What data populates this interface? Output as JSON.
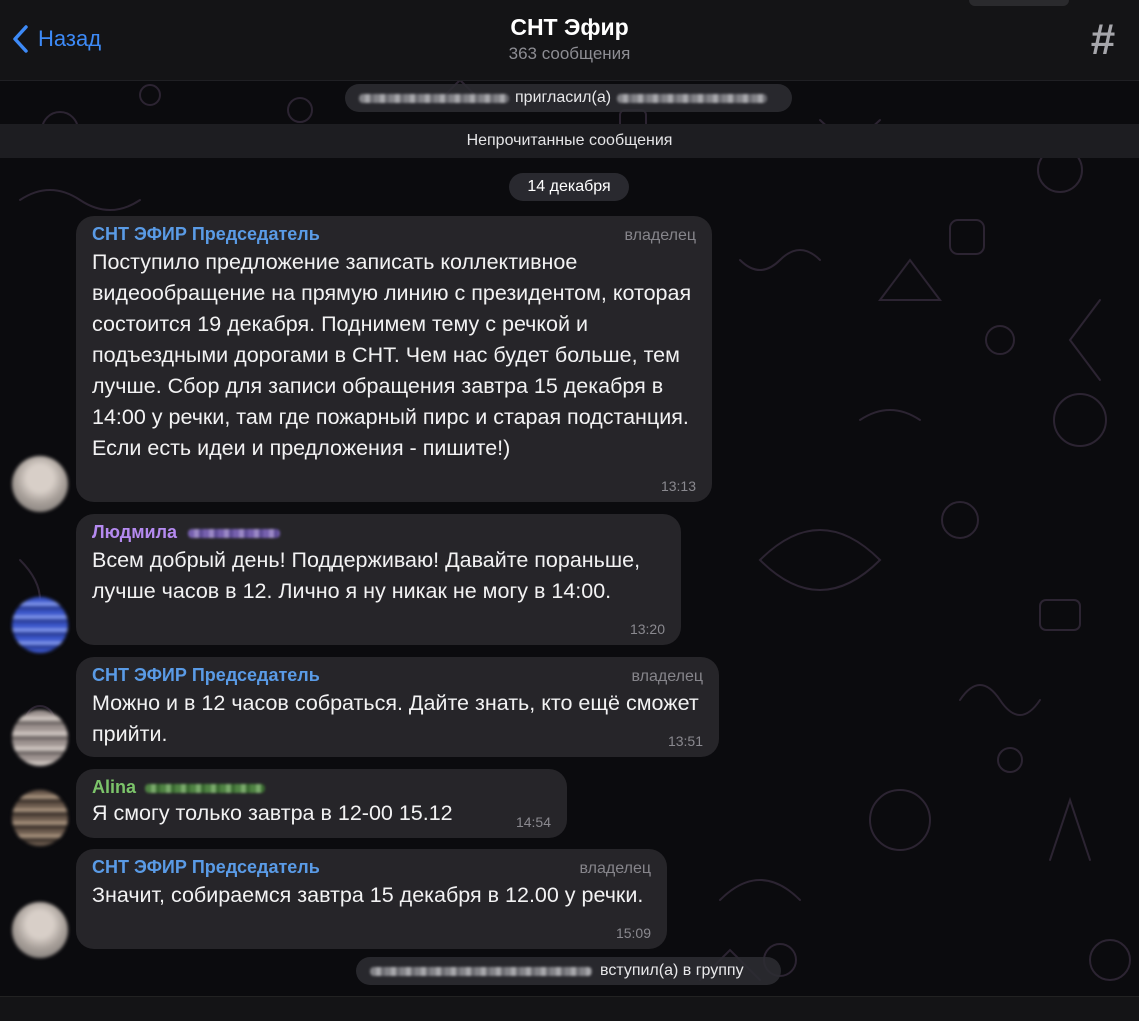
{
  "header": {
    "back_label": "Назад",
    "title": "СНТ Эфир",
    "subtitle": "363 сообщения",
    "action_icon": "hash-icon",
    "action_glyph": "#"
  },
  "service_top": {
    "text": "пригласил(а)"
  },
  "unread_label": "Непрочитанные сообщения",
  "date_label": "14 декабря",
  "colors": {
    "accent": "#3d8af7",
    "sender_admin": "#5a9be6",
    "sender_ludmila": "#b58af0",
    "sender_alina": "#7cc46a"
  },
  "messages": [
    {
      "sender": "СНТ ЭФИР Председатель",
      "badge": "владелец",
      "text": "Поступило предложение записать коллективное видеообращение на прямую линию с президентом, которая состоится 19 декабря. Поднимем тему с речкой и подъездными дорогами в СНТ. Чем нас будет больше, тем лучше. Сбор для записи обращения завтра 15 декабря в 14:00 у речки, там где пожарный пирс и старая подстанция. Если есть идеи и предложения - пишите!)",
      "time": "13:13"
    },
    {
      "sender": "Людмила",
      "badge": "",
      "text": "Всем добрый день! Поддерживаю! Давайте пораньше, лучше часов в 12. Лично я ну никак не могу в 14:00.",
      "time": "13:20"
    },
    {
      "sender": "СНТ ЭФИР Председатель",
      "badge": "владелец",
      "text": "Можно и в 12 часов собраться. Дайте знать, кто ещё сможет прийти.",
      "time": "13:51"
    },
    {
      "sender": "Alina",
      "badge": "",
      "text": "Я смогу только завтра в 12-00 15.12",
      "time": "14:54"
    },
    {
      "sender": "СНТ ЭФИР Председатель",
      "badge": "владелец",
      "text": "Значит, собираемся завтра 15 декабря в 12.00 у речки.",
      "time": "15:09"
    }
  ],
  "service_bottom": {
    "text": "вступил(а) в группу"
  }
}
